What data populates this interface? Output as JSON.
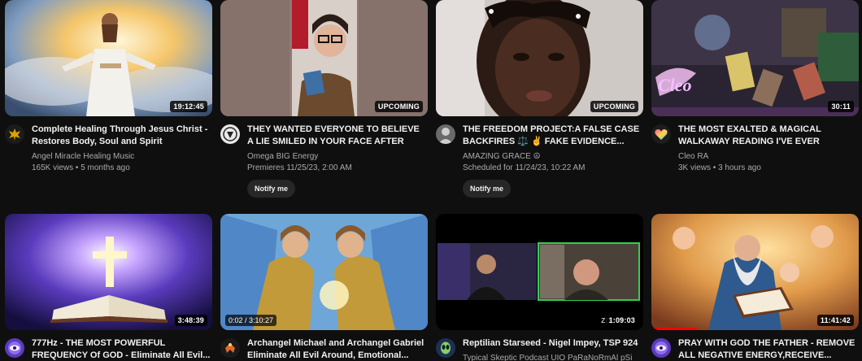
{
  "videos": [
    {
      "title": "Complete Healing Through Jesus Christ - Restores Body, Soul and Spirit",
      "channel": "Angel Miracle Healing Music",
      "stats": "165K views • 5 months ago",
      "badge": "19:12:45",
      "avatar_icon": "sun-emblem-icon"
    },
    {
      "title": "THEY WANTED EVERYONE TO BELIEVE A LIE SMILED IN YOUR FACE AFTER THEY...",
      "channel": "Omega BIG Energy",
      "stats": "Premieres 11/25/23, 2:00 AM",
      "badge": "UPCOMING",
      "notify": "Notify me",
      "avatar_icon": "emblem-icon"
    },
    {
      "title": "THE FREEDOM PROJECT:A FALSE CASE BACKFIRES ⚖️ ✌️ FAKE EVIDENCE...",
      "channel": "AMAZING GRACE ☮",
      "stats": "Scheduled for 11/24/23, 10:22 AM",
      "badge": "UPCOMING",
      "notify": "Notify me",
      "avatar_icon": "portrait-icon"
    },
    {
      "title": "THE MOST EXALTED & MAGICAL WALKAWAY READING I'VE EVER DONE!!...",
      "channel": "Cleo RA",
      "stats": "3K views • 3 hours ago",
      "badge": "30:11",
      "avatar_icon": "rainbow-heart-icon"
    },
    {
      "title": "777Hz - THE MOST POWERFUL FREQUENCY Of GOD - Eliminate All Evil...",
      "channel": "",
      "stats": "",
      "badge": "3:48:39",
      "avatar_icon": "eye-emblem-icon"
    },
    {
      "title": "Archangel Michael and Archangel Gabriel Eliminate All Evil Around, Emotional...",
      "channel": "",
      "stats": "",
      "badge": "",
      "progress_time": "0:02 / 3:10:27",
      "avatar_icon": "angel-icon"
    },
    {
      "title": "Reptilian Starseed - Nigel Impey, TSP 924",
      "channel": "Typical Skeptic Podcast UIO PaRaNoRmAl pSi",
      "stats": "",
      "badge": "1:09:03",
      "thumb_logo": "zoom",
      "avatar_icon": "alien-icon"
    },
    {
      "title": "PRAY WITH GOD THE FATHER - REMOVE ALL NEGATIVE ENERGY,RECEIVE...",
      "channel": "",
      "stats": "",
      "badge": "11:41:42",
      "watch_progress": 0.22,
      "avatar_icon": "eye-emblem-icon"
    }
  ]
}
